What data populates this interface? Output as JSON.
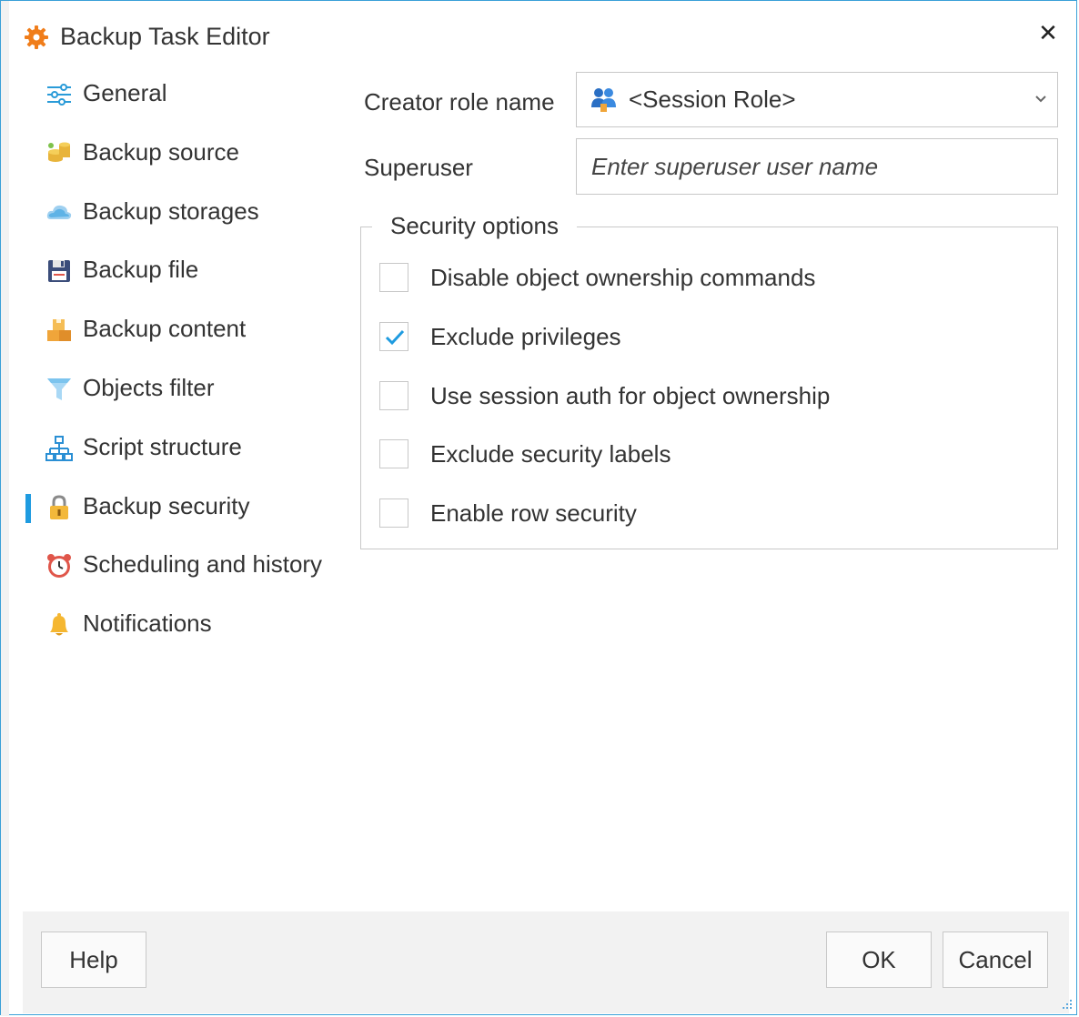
{
  "window": {
    "title": "Backup Task Editor",
    "close_glyph": "✕",
    "accent_color": "#1e9be0"
  },
  "nav": {
    "items": [
      {
        "label": "General",
        "icon": "sliders-icon"
      },
      {
        "label": "Backup source",
        "icon": "database-coins-icon"
      },
      {
        "label": "Backup storages",
        "icon": "cloud-icon"
      },
      {
        "label": "Backup file",
        "icon": "floppy-disk-icon"
      },
      {
        "label": "Backup content",
        "icon": "boxes-icon"
      },
      {
        "label": "Objects filter",
        "icon": "funnel-icon"
      },
      {
        "label": "Script structure",
        "icon": "hierarchy-icon"
      },
      {
        "label": "Backup security",
        "icon": "padlock-icon",
        "selected": true
      },
      {
        "label": "Scheduling and history",
        "icon": "alarm-clock-icon"
      },
      {
        "label": "Notifications",
        "icon": "bell-icon"
      }
    ]
  },
  "form": {
    "creator_role_label": "Creator role name",
    "creator_role_value": "<Session Role>",
    "superuser_label": "Superuser",
    "superuser_placeholder": "Enter superuser user name",
    "superuser_value": ""
  },
  "security": {
    "group_title": "Security options",
    "options": [
      {
        "label": "Disable object ownership commands",
        "checked": false
      },
      {
        "label": "Exclude privileges",
        "checked": true
      },
      {
        "label": "Use session auth for object ownership",
        "checked": false
      },
      {
        "label": "Exclude security labels",
        "checked": false
      },
      {
        "label": "Enable row security",
        "checked": false
      }
    ]
  },
  "footer": {
    "help_label": "Help",
    "ok_label": "OK",
    "cancel_label": "Cancel"
  }
}
